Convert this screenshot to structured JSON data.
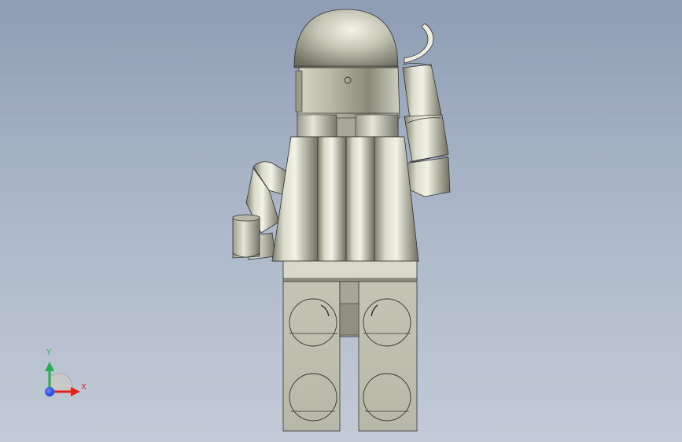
{
  "app": {
    "view": "back-view"
  },
  "model": {
    "name": "",
    "material_color": "#c9c8b8"
  },
  "triad": {
    "x_label": "X",
    "y_label": "Y",
    "x_color": "#e0231b",
    "y_color": "#22b14c",
    "z_color": "#1c3fd8"
  },
  "icons": [
    "view-triad-icon"
  ]
}
